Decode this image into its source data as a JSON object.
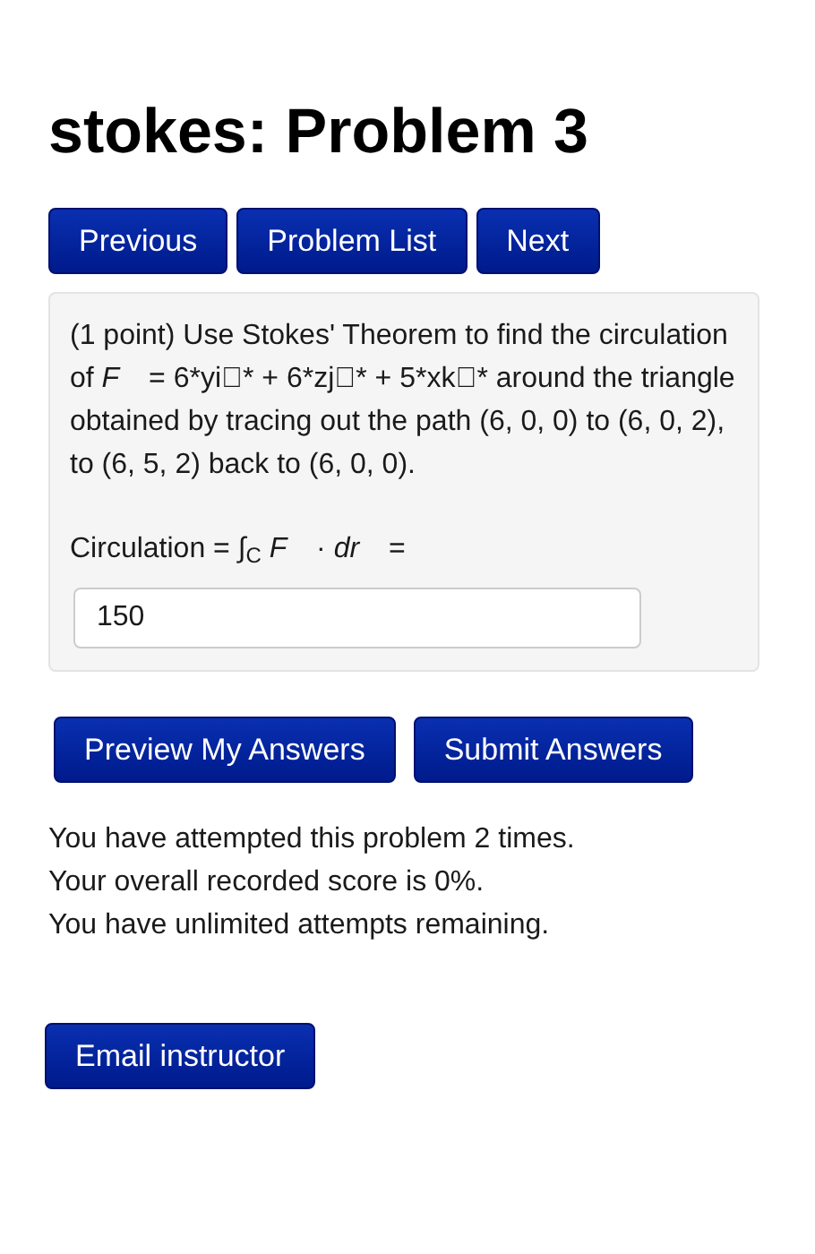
{
  "title": "stokes: Problem 3",
  "nav_buttons": [
    "Previous",
    "Problem List",
    "Next"
  ],
  "problem": {
    "text": "(1 point) Use Stokes' Theorem to find the circulation of *F⃗* = 6*yi⃗* + 6*zj⃗* + 5*xk⃗* around the triangle obtained by tracing out the path (6, 0, 0) to (6, 0, 2), to (6, 5, 2) back to (6, 0, 0).",
    "answer_label": "Circulation = ∫$_{C}$ *F⃗* · *dr⃗* =",
    "answer_value": "150"
  },
  "action_buttons": [
    "Preview My Answers",
    "Submit Answers"
  ],
  "status_lines": [
    "You have attempted this problem 2 times.",
    "Your overall recorded score is 0%.",
    "You have unlimited attempts remaining."
  ],
  "email_button": "Email instructor"
}
